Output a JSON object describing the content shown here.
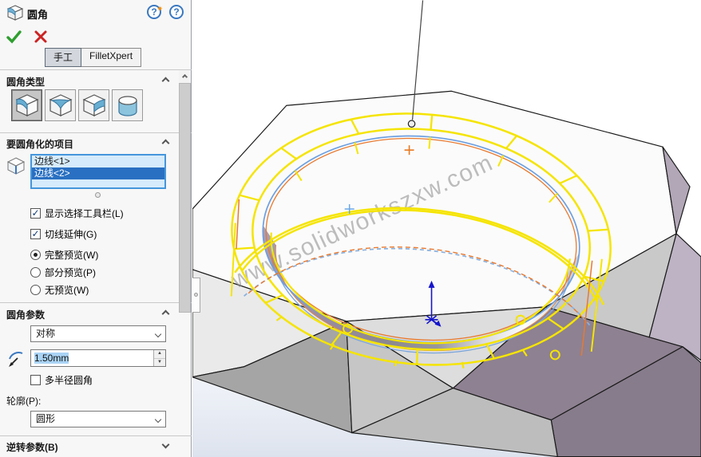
{
  "panel": {
    "title": "圆角",
    "tabs": {
      "manual": "手工",
      "expert": "FilletXpert"
    },
    "fillet_type": {
      "title": "圆角类型"
    },
    "items": {
      "title": "要圆角化的项目",
      "edges": [
        {
          "label": "边线<1>",
          "selected": false
        },
        {
          "label": "边线<2>",
          "selected": true
        }
      ],
      "checkboxes": [
        {
          "label": "显示选择工具栏(L)",
          "checked": true
        },
        {
          "label": "切线延伸(G)",
          "checked": true
        }
      ],
      "radios": [
        {
          "label": "完整预览(W)",
          "selected": true
        },
        {
          "label": "部分预览(P)",
          "selected": false
        },
        {
          "label": "无预览(W)",
          "selected": false
        }
      ]
    },
    "params": {
      "title": "圆角参数",
      "symmetry_value": "对称",
      "radius_value": "1.50mm",
      "multi_radius_label": "多半径圆角",
      "multi_radius_checked": false,
      "profile_label": "轮廓(P):",
      "profile_value": "圆形"
    },
    "setback": {
      "title": "逆转参数(B)",
      "collapsed": true
    },
    "check_glyph": "✓"
  },
  "viewport": {
    "watermark": "www.solidworkszxw.com"
  },
  "colors": {
    "selection_blue": "#2a70c2",
    "preview_yellow": "#f5e400",
    "edge_orange": "#e8792f",
    "selected_edge_blue": "#6d9fe0",
    "facet_purple": "#8e8191"
  }
}
